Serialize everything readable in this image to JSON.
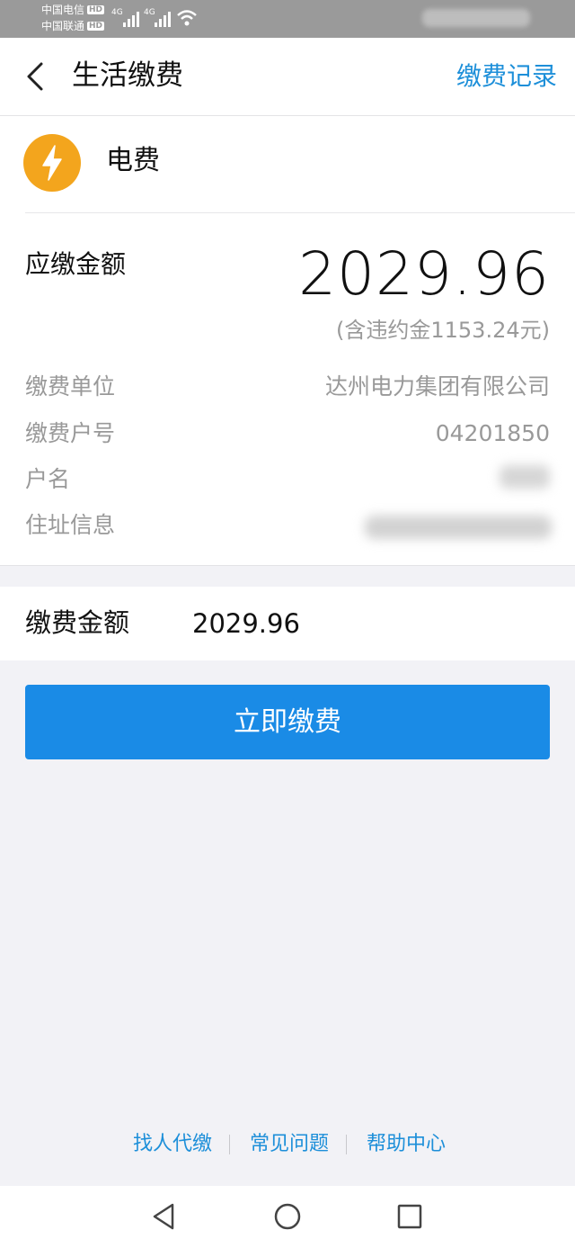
{
  "status_bar": {
    "carrier1": "中国电信",
    "carrier2": "中国联通",
    "hd_badge": "HD",
    "net1": "4G",
    "net2": "4G"
  },
  "header": {
    "title": "生活缴费",
    "records_link": "缴费记录"
  },
  "bill": {
    "icon": "lightning-bolt-icon",
    "type": "电费",
    "due_label": "应缴金额",
    "due_amount": "2029.96",
    "penalty_note": "(含违约金1153.24元)",
    "info": [
      {
        "label": "缴费单位",
        "value": "达州电力集团有限公司"
      },
      {
        "label": "缴费户号",
        "value": "04201850"
      },
      {
        "label": "户名",
        "value": ""
      },
      {
        "label": "住址信息",
        "value": ""
      }
    ]
  },
  "payment": {
    "amount_label": "缴费金额",
    "amount_value": "2029.96",
    "pay_button": "立即缴费"
  },
  "footer": {
    "links": [
      "找人代缴",
      "常见问题",
      "帮助中心"
    ]
  },
  "colors": {
    "accent": "#1a8be6",
    "link": "#1d8fd9",
    "bill_icon_bg": "#f3a51d"
  }
}
